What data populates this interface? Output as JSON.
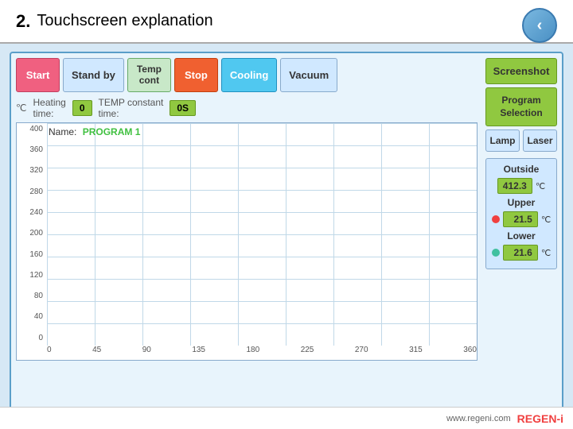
{
  "title": {
    "number": "2.",
    "text": "Touchscreen explanation"
  },
  "back_button": "‹",
  "controls": {
    "start": "Start",
    "standby": "Stand by",
    "tempcont": "Temp\ncont",
    "stop": "Stop",
    "cooling": "Cooling",
    "vacuum": "Vacuum"
  },
  "right_panel": {
    "screenshot": "Screenshot",
    "program_selection": "Program\nSelection",
    "lamp": "Lamp",
    "laser": "Laser"
  },
  "sensors": {
    "outside_label": "Outside",
    "outside_value": "412.3",
    "outside_unit": "℃",
    "upper_label": "Upper",
    "upper_value": "21.5",
    "upper_unit": "℃",
    "lower_label": "Lower",
    "lower_value": "21.6",
    "lower_unit": "℃"
  },
  "chart": {
    "temp_unit": "℃",
    "heating_time_label": "Heating\ntime:",
    "heating_time_value": "0",
    "temp_constant_label": "TEMP constant\ntime:",
    "temp_constant_value": "0S",
    "name_label": "Name:",
    "name_value": "PROGRAM 1",
    "y_labels": [
      "0",
      "40",
      "80",
      "120",
      "160",
      "200",
      "240",
      "280",
      "320",
      "360",
      "400"
    ],
    "x_labels": [
      "0",
      "45",
      "90",
      "135",
      "180",
      "225",
      "270",
      "315",
      "360"
    ]
  },
  "footer": {
    "website": "www.regeni.com",
    "brand": "REGEN",
    "brand_suffix": "-i"
  }
}
